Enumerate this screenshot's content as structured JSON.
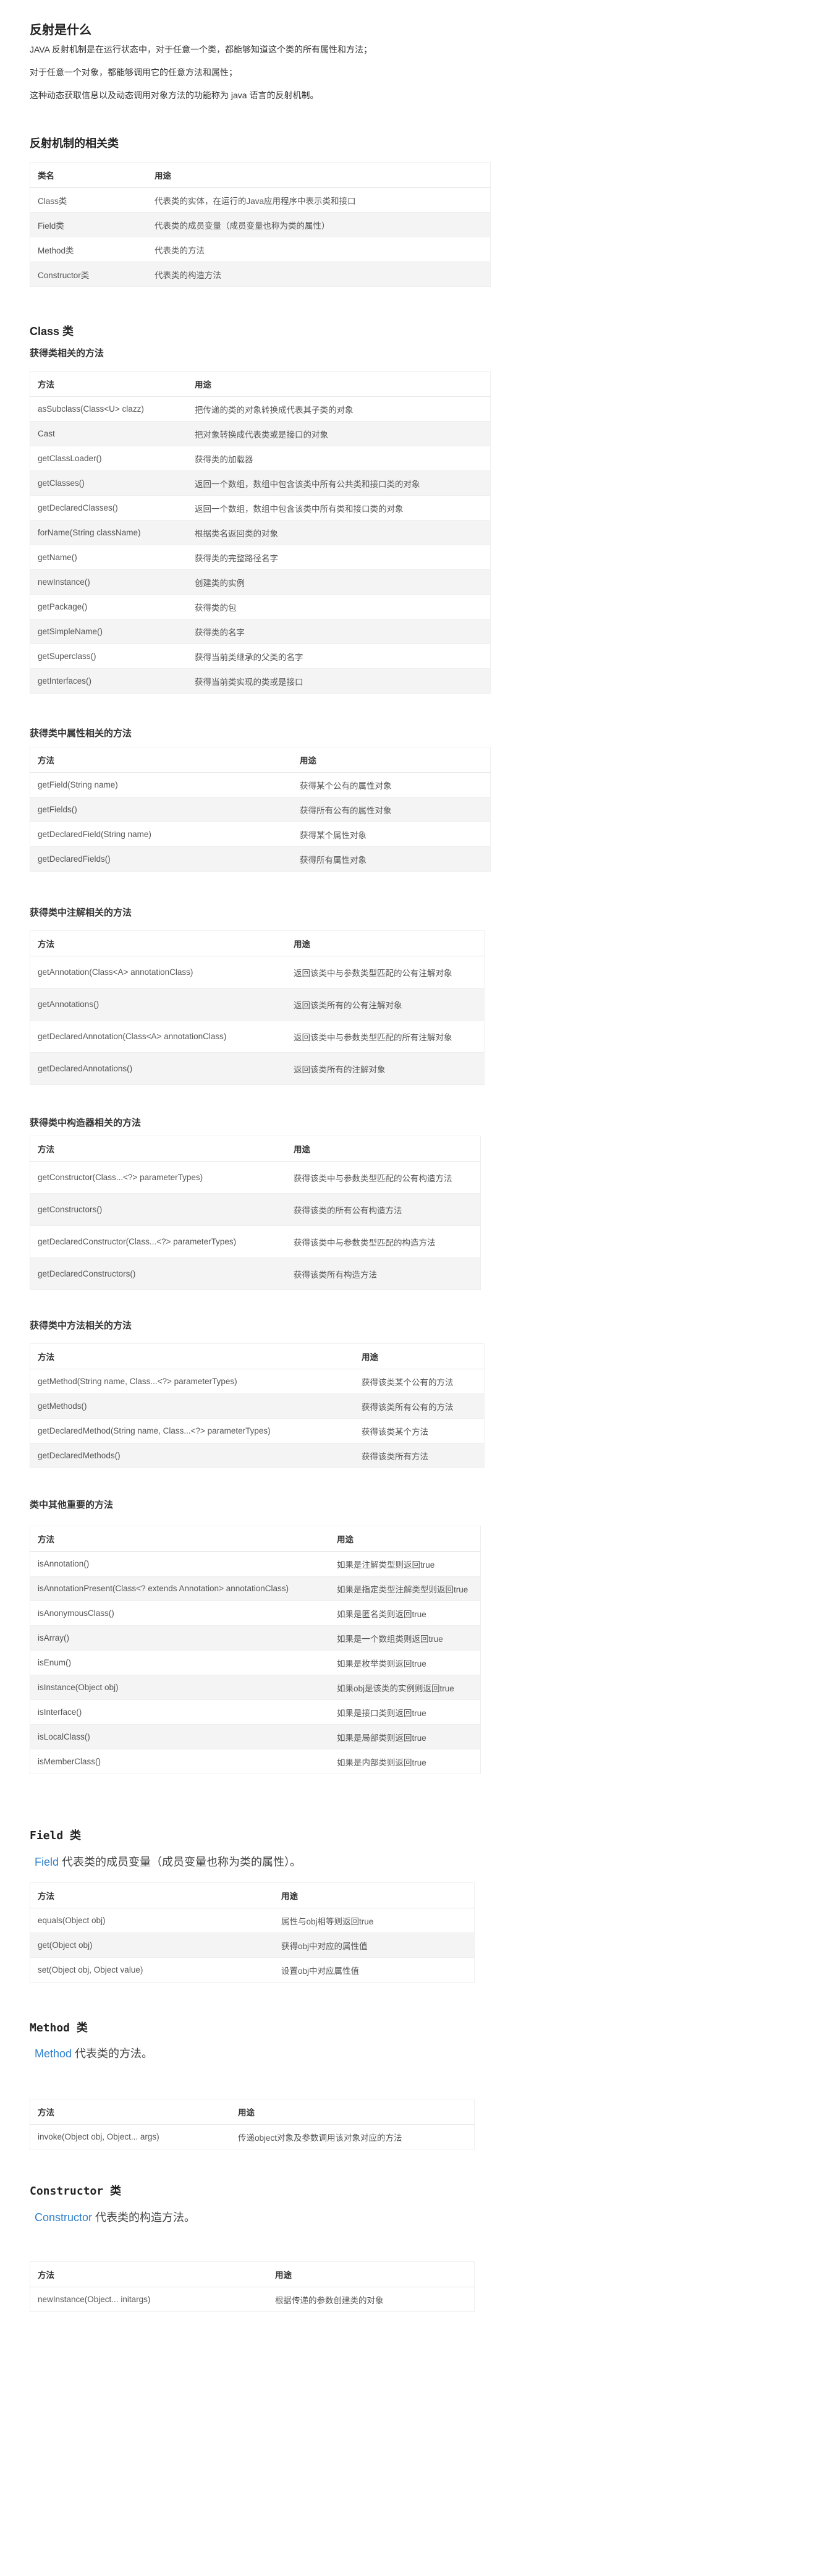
{
  "title": "反射是什么",
  "intro": [
    "JAVA 反射机制是在运行状态中，对于任意一个类，都能够知道这个类的所有属性和方法；",
    "对于任意一个对象，都能够调用它的任意方法和属性；",
    "这种动态获取信息以及动态调用对象方法的功能称为 java 语言的反射机制。"
  ],
  "classes_section": {
    "heading": "反射机制的相关类",
    "headers": [
      "类名",
      "用途"
    ],
    "rows": [
      [
        "Class类",
        "代表类的实体，在运行的Java应用程序中表示类和接口"
      ],
      [
        "Field类",
        "代表类的成员变量（成员变量也称为类的属性）"
      ],
      [
        "Method类",
        "代表类的方法"
      ],
      [
        "Constructor类",
        "代表类的构造方法"
      ]
    ]
  },
  "class_section": {
    "heading": "Class 类",
    "sub_heading": "获得类相关的方法",
    "headers": [
      "方法",
      "用途"
    ],
    "rows": [
      [
        "asSubclass(Class<U> clazz)",
        "把传递的类的对象转换成代表其子类的对象"
      ],
      [
        "Cast",
        "把对象转换成代表类或是接口的对象"
      ],
      [
        "getClassLoader()",
        "获得类的加载器"
      ],
      [
        "getClasses()",
        "返回一个数组，数组中包含该类中所有公共类和接口类的对象"
      ],
      [
        "getDeclaredClasses()",
        "返回一个数组，数组中包含该类中所有类和接口类的对象"
      ],
      [
        "forName(String className)",
        "根据类名返回类的对象"
      ],
      [
        "getName()",
        "获得类的完整路径名字"
      ],
      [
        "newInstance()",
        "创建类的实例"
      ],
      [
        "getPackage()",
        "获得类的包"
      ],
      [
        "getSimpleName()",
        "获得类的名字"
      ],
      [
        "getSuperclass()",
        "获得当前类继承的父类的名字"
      ],
      [
        "getInterfaces()",
        "获得当前类实现的类或是接口"
      ]
    ]
  },
  "fields_section": {
    "heading": "获得类中属性相关的方法",
    "headers": [
      "方法",
      "用途"
    ],
    "rows": [
      [
        "getField(String name)",
        "获得某个公有的属性对象"
      ],
      [
        "getFields()",
        "获得所有公有的属性对象"
      ],
      [
        "getDeclaredField(String name)",
        "获得某个属性对象"
      ],
      [
        "getDeclaredFields()",
        "获得所有属性对象"
      ]
    ]
  },
  "annotations_section": {
    "heading": "获得类中注解相关的方法",
    "headers": [
      "方法",
      "用途"
    ],
    "rows": [
      [
        "getAnnotation(Class<A> annotationClass)",
        "返回该类中与参数类型匹配的公有注解对象"
      ],
      [
        "getAnnotations()",
        "返回该类所有的公有注解对象"
      ],
      [
        "getDeclaredAnnotation(Class<A> annotationClass)",
        "返回该类中与参数类型匹配的所有注解对象"
      ],
      [
        "getDeclaredAnnotations()",
        "返回该类所有的注解对象"
      ]
    ]
  },
  "constructors_section": {
    "heading": "获得类中构造器相关的方法",
    "headers": [
      "方法",
      "用途"
    ],
    "rows": [
      [
        "getConstructor(Class...<?> parameterTypes)",
        "获得该类中与参数类型匹配的公有构造方法"
      ],
      [
        "getConstructors()",
        "获得该类的所有公有构造方法"
      ],
      [
        "getDeclaredConstructor(Class...<?> parameterTypes)",
        "获得该类中与参数类型匹配的构造方法"
      ],
      [
        "getDeclaredConstructors()",
        "获得该类所有构造方法"
      ]
    ]
  },
  "methods_section": {
    "heading": "获得类中方法相关的方法",
    "headers": [
      "方法",
      "用途"
    ],
    "rows": [
      [
        "getMethod(String name, Class...<?> parameterTypes)",
        "获得该类某个公有的方法"
      ],
      [
        "getMethods()",
        "获得该类所有公有的方法"
      ],
      [
        "getDeclaredMethod(String name, Class...<?> parameterTypes)",
        "获得该类某个方法"
      ],
      [
        "getDeclaredMethods()",
        "获得该类所有方法"
      ]
    ]
  },
  "other_section": {
    "heading": "类中其他重要的方法",
    "headers": [
      "方法",
      "用途"
    ],
    "rows": [
      [
        "isAnnotation()",
        "如果是注解类型则返回true"
      ],
      [
        "isAnnotationPresent(Class<? extends Annotation> annotationClass)",
        "如果是指定类型注解类型则返回true"
      ],
      [
        "isAnonymousClass()",
        "如果是匿名类则返回true"
      ],
      [
        "isArray()",
        "如果是一个数组类则返回true"
      ],
      [
        "isEnum()",
        "如果是枚举类则返回true"
      ],
      [
        "isInstance(Object obj)",
        "如果obj是该类的实例则返回true"
      ],
      [
        "isInterface()",
        "如果是接口类则返回true"
      ],
      [
        "isLocalClass()",
        "如果是局部类则返回true"
      ],
      [
        "isMemberClass()",
        "如果是内部类则返回true"
      ]
    ]
  },
  "field_section": {
    "heading": "Field 类",
    "lead_keyword": "Field",
    "lead_text": " 代表类的成员变量（成员变量也称为类的属性）。",
    "headers": [
      "方法",
      "用途"
    ],
    "rows": [
      [
        "equals(Object obj)",
        "属性与obj相等则返回true"
      ],
      [
        "get(Object obj)",
        "获得obj中对应的属性值"
      ],
      [
        "set(Object obj, Object value)",
        "设置obj中对应属性值"
      ]
    ]
  },
  "method_section": {
    "heading": "Method 类",
    "lead_keyword": "Method",
    "lead_text": " 代表类的方法。",
    "headers": [
      "方法",
      "用途"
    ],
    "rows": [
      [
        "invoke(Object obj, Object... args)",
        "传递object对象及参数调用该对象对应的方法"
      ]
    ]
  },
  "constructor_section": {
    "heading": "Constructor 类",
    "lead_keyword": "Constructor",
    "lead_text": " 代表类的构造方法。",
    "headers": [
      "方法",
      "用途"
    ],
    "rows": [
      [
        "newInstance(Object... initargs)",
        "根据传递的参数创建类的对象"
      ]
    ]
  }
}
